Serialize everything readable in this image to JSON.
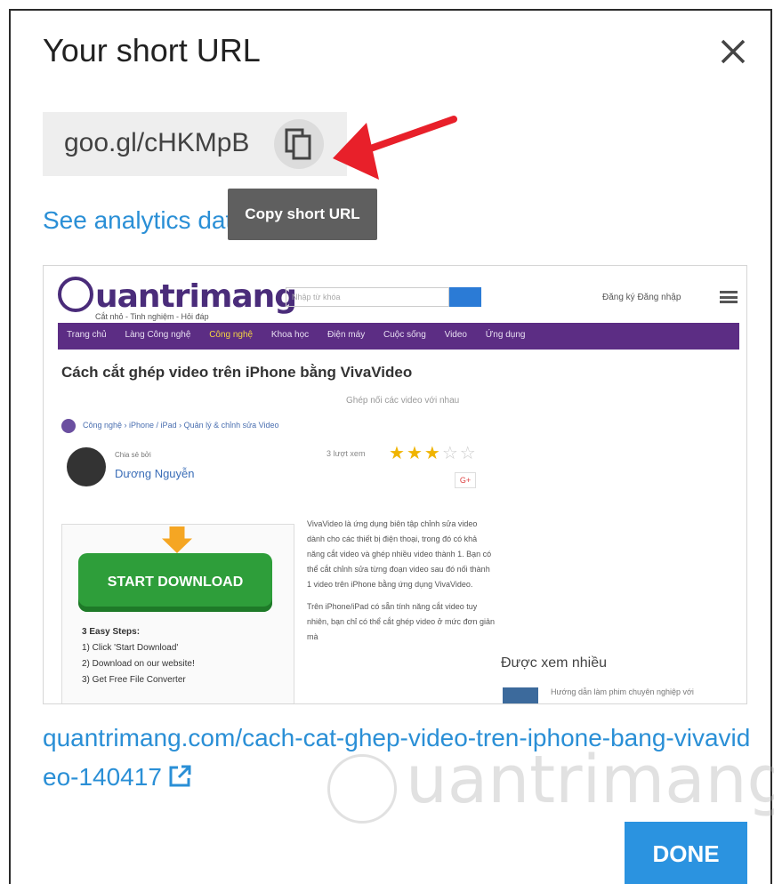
{
  "dialog": {
    "title": "Your short URL",
    "short_url": "goo.gl/cHKMpB",
    "copy_tooltip": "Copy short URL",
    "analytics_link": "See analytics dat",
    "long_url": "quantrimang.com/cach-cat-ghep-video-tren-iphone-bang-vivavideo-140417",
    "done_label": "DONE"
  },
  "preview": {
    "logo": "uantrimang",
    "tagline": "Cắt nhỏ - Tinh nghiệm - Hỏi đáp",
    "search_placeholder": "Nhập từ khóa",
    "auth": "Đăng ký  Đăng nhập",
    "nav": [
      "Trang chủ",
      "Làng Công nghệ",
      "Công nghệ",
      "Khoa học",
      "Điện máy",
      "Cuộc sống",
      "Video",
      "Ứng dụng"
    ],
    "headline": "Cách cắt ghép video trên iPhone bằng VivaVideo",
    "subline": "Ghép nối các video với nhau",
    "breadcrumb": "Công nghệ  ›  iPhone / iPad  ›  Quản lý & chỉnh sửa Video",
    "author_label": "Chia sẻ bởi",
    "author": "Dương Nguyễn",
    "views": "3 lượt xem",
    "rating": 3,
    "rating_max": 5,
    "gplus": "G+",
    "ad_button": "START DOWNLOAD",
    "ad_steps_title": "3 Easy Steps:",
    "ad_steps": [
      "1) Click 'Start Download'",
      "2) Download on our website!",
      "3) Get Free File Converter"
    ],
    "body_text_1": "VivaVideo là ứng dụng biên tập chỉnh sửa video dành cho các thiết bị điện thoại, trong đó có khả năng cắt video và ghép nhiều video thành 1. Bạn có thể cắt chỉnh sửa từng đoạn video sau đó nối thành 1 video trên iPhone bằng ứng dụng VivaVideo.",
    "body_text_2": "Trên iPhone/iPad có sẵn tính năng cắt video tuy nhiên, bạn chỉ có thể cắt ghép video ở mức đơn giản mà",
    "popular_title": "Được xem nhiều",
    "popular_item": "Hướng dẫn làm phim chuyên nghiệp với"
  },
  "watermark": "uantrimang",
  "colors": {
    "link": "#2a8fd6",
    "button": "#2b93e0",
    "arrow": "#e8202a",
    "tooltip": "#5f5f5f",
    "nav": "#5c2d84"
  },
  "icons": {
    "close": "close-icon",
    "copy": "copy-icon",
    "external": "external-link-icon",
    "arrow": "red-arrow-annotation"
  }
}
